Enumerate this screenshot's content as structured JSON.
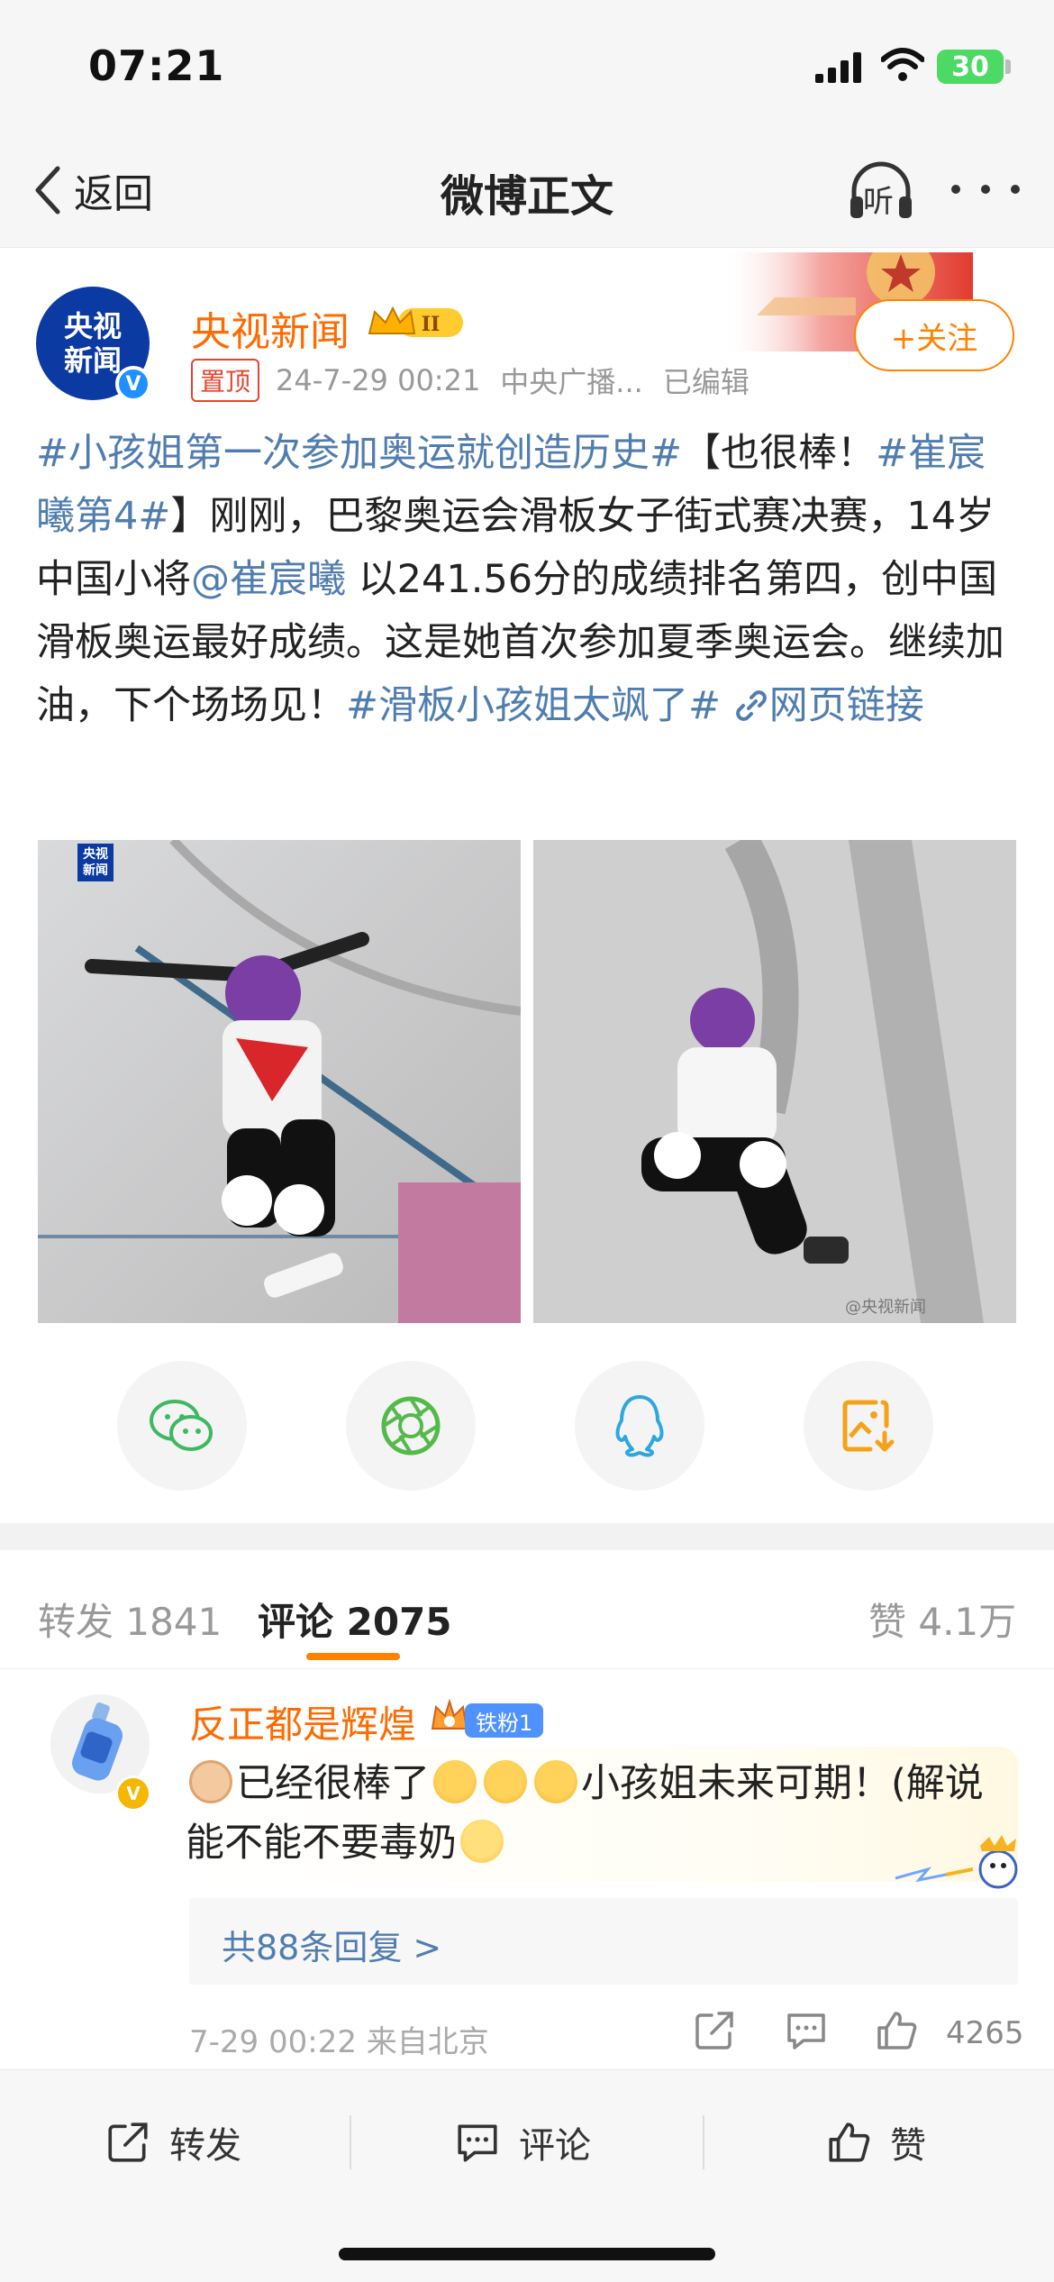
{
  "status_bar": {
    "time": "07:21",
    "battery": "30"
  },
  "nav": {
    "back_label": "返回",
    "title": "微博正文",
    "listen_label": "听"
  },
  "post": {
    "author": "央视新闻",
    "avatar_text_1": "央视",
    "avatar_text_2": "新闻",
    "vip_level": "II",
    "follow_label": "+关注",
    "pinned_tag": "置顶",
    "timestamp": "24-7-29 00:21",
    "source": "中央广播...",
    "edited": "已编辑",
    "text_parts": {
      "topic1": "#小孩姐第一次参加奥运就创造历史#",
      "t1": "【也很棒！",
      "topic2": "#崔宸曦第4#",
      "t2": "】刚刚，巴黎奥运会滑板女子街式赛决赛，14岁中国小将",
      "mention": "@崔宸曦",
      "t3": " 以241.56分的成绩排名第四，创中国滑板奥运最好成绩。这是她首次参加夏季奥运会。继续加油，下个场场见！",
      "topic3": "#滑板小孩姐太飒了#",
      "link": "网页链接"
    },
    "image1_watermark": "央视\n新闻",
    "image2_watermark": "@央视新闻"
  },
  "share": {
    "icons": [
      "wechat-icon",
      "moments-icon",
      "qq-icon",
      "save-image-icon"
    ]
  },
  "tabs": {
    "repost": "转发 1841",
    "comments": "评论 2075",
    "likes": "赞 4.1万"
  },
  "comment": {
    "user": "反正都是辉煌",
    "fan_badge": "铁粉1",
    "text_a": "已经很棒了",
    "text_b": "小孩姐未来可期！(解说能不能不要毒奶",
    "replies": "共88条回复 >",
    "meta": "7-29 00:22  来自北京",
    "like_count": "4265"
  },
  "toolbar": {
    "repost": "转发",
    "comment": "评论",
    "like": "赞"
  },
  "colors": {
    "accent": "#ff8200",
    "link": "#507daf",
    "name": "#ff6a00"
  }
}
